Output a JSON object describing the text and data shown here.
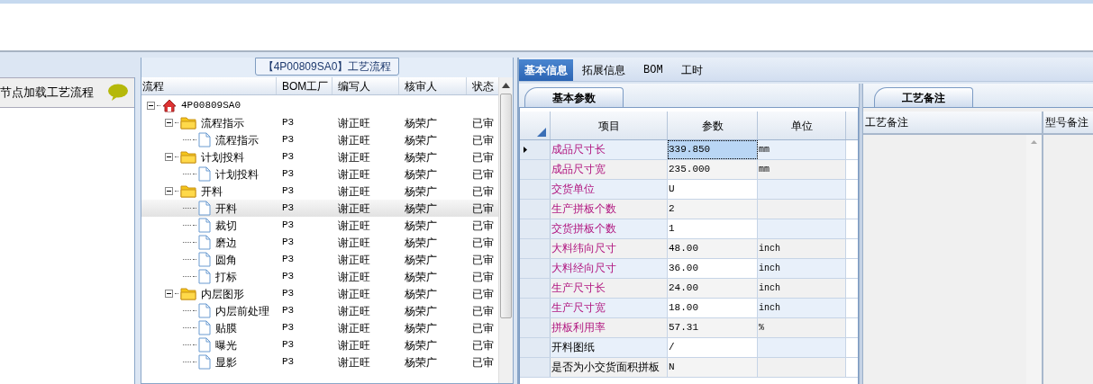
{
  "left_panel": {
    "title": "节点加载工艺流程"
  },
  "flow_panel": {
    "title": "【4P00809SA0】工艺流程",
    "columns": [
      "流程",
      "BOM工厂",
      "编写人",
      "核审人",
      "状态"
    ],
    "tree": [
      {
        "label": "4P00809SA0",
        "kind": "root",
        "expanded": true,
        "children": [
          {
            "label": "流程指示",
            "kind": "folder",
            "expanded": true,
            "cells": [
              "P3",
              "谢正旺",
              "杨荣广",
              "已审"
            ],
            "children": [
              {
                "label": "流程指示",
                "kind": "file",
                "selected": false,
                "cells": [
                  "P3",
                  "谢正旺",
                  "杨荣广",
                  "已审"
                ]
              }
            ]
          },
          {
            "label": "计划投料",
            "kind": "folder",
            "expanded": true,
            "cells": [
              "P3",
              "谢正旺",
              "杨荣广",
              "已审"
            ],
            "children": [
              {
                "label": "计划投料",
                "kind": "file",
                "selected": false,
                "cells": [
                  "P3",
                  "谢正旺",
                  "杨荣广",
                  "已审"
                ]
              }
            ]
          },
          {
            "label": "开料",
            "kind": "folder",
            "expanded": true,
            "cells": [
              "P3",
              "谢正旺",
              "杨荣广",
              "已审"
            ],
            "children": [
              {
                "label": "开料",
                "kind": "file",
                "selected": true,
                "cells": [
                  "P3",
                  "谢正旺",
                  "杨荣广",
                  "已审"
                ]
              },
              {
                "label": "裁切",
                "kind": "file",
                "selected": false,
                "cells": [
                  "P3",
                  "谢正旺",
                  "杨荣广",
                  "已审"
                ]
              },
              {
                "label": "磨边",
                "kind": "file",
                "selected": false,
                "cells": [
                  "P3",
                  "谢正旺",
                  "杨荣广",
                  "已审"
                ]
              },
              {
                "label": "圆角",
                "kind": "file",
                "selected": false,
                "cells": [
                  "P3",
                  "谢正旺",
                  "杨荣广",
                  "已审"
                ]
              },
              {
                "label": "打标",
                "kind": "file",
                "selected": false,
                "cells": [
                  "P3",
                  "谢正旺",
                  "杨荣广",
                  "已审"
                ]
              }
            ]
          },
          {
            "label": "内层图形",
            "kind": "folder",
            "expanded": true,
            "cells": [
              "P3",
              "谢正旺",
              "杨荣广",
              "已审"
            ],
            "children": [
              {
                "label": "内层前处理",
                "kind": "file",
                "selected": false,
                "cells": [
                  "P3",
                  "谢正旺",
                  "杨荣广",
                  "已审"
                ]
              },
              {
                "label": "贴膜",
                "kind": "file",
                "selected": false,
                "cells": [
                  "P3",
                  "谢正旺",
                  "杨荣广",
                  "已审"
                ]
              },
              {
                "label": "曝光",
                "kind": "file",
                "selected": false,
                "cells": [
                  "P3",
                  "谢正旺",
                  "杨荣广",
                  "已审"
                ]
              },
              {
                "label": "显影",
                "kind": "file",
                "selected": false,
                "cells": [
                  "P3",
                  "谢正旺",
                  "杨荣广",
                  "已审"
                ]
              }
            ]
          }
        ]
      }
    ]
  },
  "tabs": [
    {
      "label": "基本信息",
      "selected": true
    },
    {
      "label": "拓展信息",
      "selected": false
    },
    {
      "label": "BOM",
      "selected": false
    },
    {
      "label": "工时",
      "selected": false
    }
  ],
  "params_panel": {
    "tab": "基本参数",
    "columns": [
      "项目",
      "参数",
      "单位"
    ],
    "rows": [
      {
        "item": "成品尺寸长",
        "value": "339.850",
        "unit": "mm",
        "emphasized": true,
        "selected": true
      },
      {
        "item": "成品尺寸宽",
        "value": "235.000",
        "unit": "mm",
        "emphasized": true,
        "selected": false
      },
      {
        "item": "交货单位",
        "value": "U",
        "emphasized": true,
        "selected": false
      },
      {
        "item": "生产拼板个数",
        "value": "2",
        "emphasized": true,
        "selected": false
      },
      {
        "item": "交货拼板个数",
        "value": "1",
        "emphasized": true,
        "selected": false
      },
      {
        "item": "大料纬向尺寸",
        "value": "48.00",
        "unit": "inch",
        "emphasized": true,
        "selected": false
      },
      {
        "item": "大料经向尺寸",
        "value": "36.00",
        "unit": "inch",
        "emphasized": true,
        "selected": false
      },
      {
        "item": "生产尺寸长",
        "value": "24.00",
        "unit": "inch",
        "emphasized": true,
        "selected": false
      },
      {
        "item": "生产尺寸宽",
        "value": "18.00",
        "unit": "inch",
        "emphasized": true,
        "selected": false
      },
      {
        "item": "拼板利用率",
        "value": "57.31",
        "unit": "%",
        "emphasized": true,
        "selected": false
      },
      {
        "item": "开料图纸",
        "value": "/",
        "emphasized": false,
        "selected": false
      },
      {
        "item": "是否为小交货面积拼板",
        "value": "N",
        "emphasized": false,
        "selected": false
      }
    ]
  },
  "notes_panel": {
    "tab": "工艺备注",
    "columns": [
      "工艺备注",
      "型号备注"
    ]
  }
}
